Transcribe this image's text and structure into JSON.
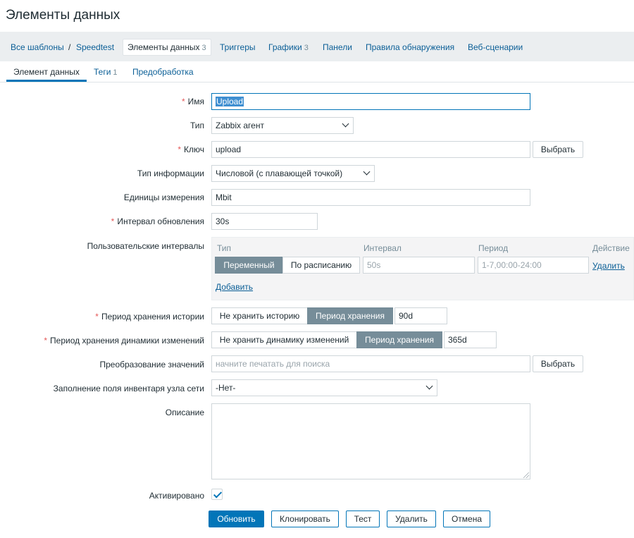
{
  "page": {
    "title": "Элементы данных"
  },
  "nav": {
    "all_templates": "Все шаблоны",
    "separator": "/",
    "template_name": "Speedtest",
    "items": {
      "label": "Элементы данных",
      "count": "3"
    },
    "triggers": "Триггеры",
    "graphs": {
      "label": "Графики",
      "count": "3"
    },
    "dashboards": "Панели",
    "discovery": "Правила обнаружения",
    "web": "Веб-сценарии"
  },
  "tabs": {
    "item": "Элемент данных",
    "tags": {
      "label": "Теги",
      "count": "1"
    },
    "preprocessing": "Предобработка"
  },
  "form": {
    "name": {
      "label": "Имя",
      "value": "Upload"
    },
    "type": {
      "label": "Тип",
      "value": "Zabbix агент"
    },
    "key": {
      "label": "Ключ",
      "value": "upload",
      "select_button": "Выбрать"
    },
    "value_type": {
      "label": "Тип информации",
      "value": "Числовой (с плавающей точкой)"
    },
    "units": {
      "label": "Единицы измерения",
      "value": "Mbit"
    },
    "delay": {
      "label": "Интервал обновления",
      "value": "30s"
    },
    "custom_intervals": {
      "label": "Пользовательские интервалы",
      "col_type": "Тип",
      "col_interval": "Интервал",
      "col_period": "Период",
      "col_action": "Действие",
      "type_flexible": "Переменный",
      "type_scheduling": "По расписанию",
      "interval_placeholder": "50s",
      "period_placeholder": "1-7,00:00-24:00",
      "remove": "Удалить",
      "add": "Добавить"
    },
    "history": {
      "label": "Период хранения истории",
      "opt_off": "Не хранить историю",
      "opt_on": "Период хранения",
      "value": "90d"
    },
    "trends": {
      "label": "Период хранения динамики изменений",
      "opt_off": "Не хранить динамику изменений",
      "opt_on": "Период хранения",
      "value": "365d"
    },
    "valuemap": {
      "label": "Преобразование значений",
      "placeholder": "начните печатать для поиска",
      "select_button": "Выбрать"
    },
    "inventory": {
      "label": "Заполнение поля инвентаря узла сети",
      "value": "-Нет-"
    },
    "description": {
      "label": "Описание",
      "value": ""
    },
    "enabled": {
      "label": "Активировано"
    }
  },
  "actions": {
    "update": "Обновить",
    "clone": "Клонировать",
    "test": "Тест",
    "delete": "Удалить",
    "cancel": "Отмена"
  }
}
